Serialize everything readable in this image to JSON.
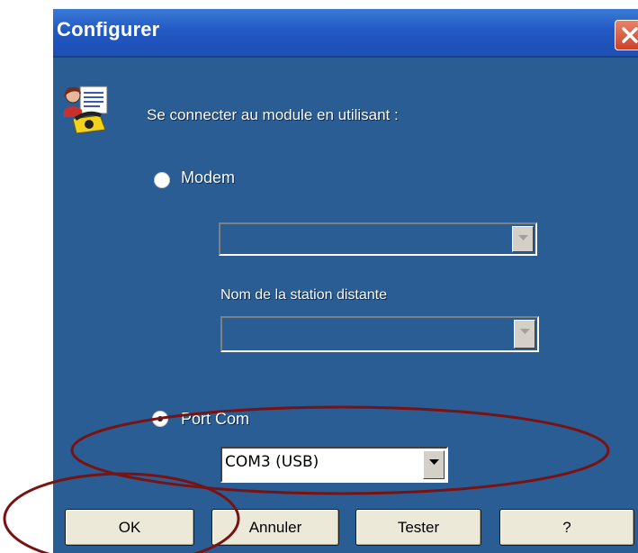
{
  "window": {
    "title": "Configurer"
  },
  "labels": {
    "connect": "Se connecter au module en utilisant :",
    "modem": "Modem",
    "station": "Nom de la station distante",
    "port_com": "Port Com"
  },
  "modem": {
    "checked": false,
    "selected": ""
  },
  "station": {
    "selected": ""
  },
  "port_com": {
    "checked": true,
    "selected": "COM3 (USB)"
  },
  "buttons": {
    "ok": "OK",
    "annuler": "Annuler",
    "tester": "Tester",
    "help": "?"
  },
  "icons": [
    "phone-connection-icon",
    "close-icon",
    "dropdown-arrow-icon"
  ],
  "colors": {
    "dialog_bg": "#295d94",
    "titlebar": "#2259c4",
    "annotation": "#7a1212",
    "button_bg": "#ece9d8"
  }
}
